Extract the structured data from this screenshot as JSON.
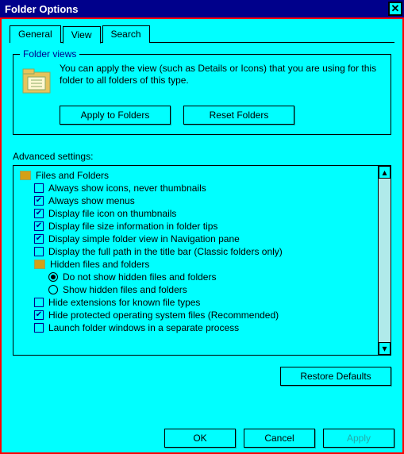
{
  "window": {
    "title": "Folder Options"
  },
  "tabs": {
    "general": "General",
    "view": "View",
    "search": "Search"
  },
  "folderViews": {
    "legend": "Folder views",
    "text": "You can apply the view (such as Details or Icons) that you are using for this folder to all folders of this type.",
    "apply": "Apply to Folders",
    "reset": "Reset Folders"
  },
  "advanced": {
    "label": "Advanced settings:",
    "group": "Files and Folders",
    "items": [
      {
        "label": "Always show icons, never thumbnails",
        "checked": false
      },
      {
        "label": "Always show menus",
        "checked": true
      },
      {
        "label": "Display file icon on thumbnails",
        "checked": true
      },
      {
        "label": "Display file size information in folder tips",
        "checked": true
      },
      {
        "label": "Display simple folder view in Navigation pane",
        "checked": true
      },
      {
        "label": "Display the full path in the title bar (Classic folders only)",
        "checked": false
      }
    ],
    "hiddenGroup": "Hidden files and folders",
    "radios": [
      {
        "label": "Do not show hidden files and folders",
        "selected": true
      },
      {
        "label": "Show hidden files and folders",
        "selected": false
      }
    ],
    "items2": [
      {
        "label": "Hide extensions for known file types",
        "checked": false
      },
      {
        "label": "Hide protected operating system files (Recommended)",
        "checked": true
      },
      {
        "label": "Launch folder windows in a separate process",
        "checked": false
      }
    ]
  },
  "restore": "Restore Defaults",
  "buttons": {
    "ok": "OK",
    "cancel": "Cancel",
    "apply": "Apply"
  }
}
